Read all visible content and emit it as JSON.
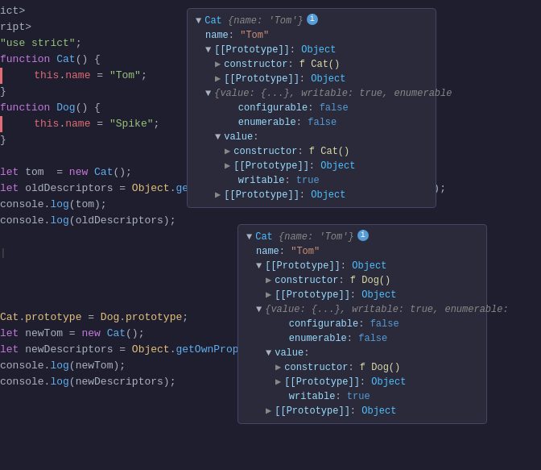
{
  "code": {
    "lines": [
      {
        "num": "",
        "bar": false,
        "content": "ict>"
      },
      {
        "num": "",
        "bar": false,
        "content": "ript>"
      },
      {
        "num": "",
        "bar": false,
        "content": "\"use strict\";"
      },
      {
        "num": "",
        "bar": false,
        "content": "function Cat() {"
      },
      {
        "num": "",
        "bar": true,
        "content": "    this.name = \"Tom\";"
      },
      {
        "num": "",
        "bar": false,
        "content": "}"
      },
      {
        "num": "",
        "bar": false,
        "content": "function Dog() {"
      },
      {
        "num": "",
        "bar": true,
        "content": "    this.name = \"Spike\";"
      },
      {
        "num": "",
        "bar": false,
        "content": "}"
      },
      {
        "num": "",
        "bar": false,
        "content": ""
      },
      {
        "num": "",
        "bar": false,
        "content": "let tom  = new Cat();"
      },
      {
        "num": "",
        "bar": false,
        "content": "let oldDescriptors = Object.getOwnPropertyDescriptor(Cat, 'prototype');"
      },
      {
        "num": "",
        "bar": false,
        "content": "console.log(tom);"
      },
      {
        "num": "",
        "bar": false,
        "content": "console.log(oldDescriptors);"
      },
      {
        "num": "",
        "bar": false,
        "content": ""
      },
      {
        "num": "",
        "bar": false,
        "content": ""
      },
      {
        "num": "",
        "bar": false,
        "content": ""
      },
      {
        "num": "",
        "bar": false,
        "content": ""
      },
      {
        "num": "",
        "bar": false,
        "content": ""
      },
      {
        "num": "",
        "bar": false,
        "content": "Cat.prototype = Dog.prototype;"
      },
      {
        "num": "",
        "bar": false,
        "content": "let newTom = new Cat();"
      },
      {
        "num": "",
        "bar": false,
        "content": "let newDescriptors = Object.getOwnPropertyDescriptor(Cat, 'prototype');"
      },
      {
        "num": "",
        "bar": false,
        "content": "console.log(newTom);"
      },
      {
        "num": "",
        "bar": false,
        "content": "console.log(newDescriptors);"
      }
    ],
    "popup1": {
      "title": "Cat {name: 'Tom'}",
      "info": true,
      "rows": [
        {
          "indent": 1,
          "tri": false,
          "key": "name",
          "sep": ": ",
          "val": "\"Tom\"",
          "valClass": "pop-val-str"
        },
        {
          "indent": 1,
          "tri": true,
          "triDown": true,
          "key": "[[Prototype]]",
          "sep": ": ",
          "val": "Object",
          "valClass": "pop-val-obj"
        },
        {
          "indent": 2,
          "tri": true,
          "triDown": false,
          "key": "constructor",
          "sep": ": ",
          "val": "f Cat()",
          "valClass": "pop-val-fn"
        },
        {
          "indent": 2,
          "tri": true,
          "triDown": false,
          "key": "[[Prototype]]",
          "sep": ": ",
          "val": "Object",
          "valClass": "pop-val-obj"
        },
        {
          "indent": 1,
          "tri": true,
          "triDown": true,
          "key": "{value: {...}, writable: true, enumerable",
          "sep": "",
          "val": "",
          "valClass": ""
        },
        {
          "indent": 2,
          "tri": false,
          "key": "configurable",
          "sep": ": ",
          "val": "false",
          "valClass": "pop-bool"
        },
        {
          "indent": 2,
          "tri": false,
          "key": "enumerable",
          "sep": ": ",
          "val": "false",
          "valClass": "pop-bool"
        },
        {
          "indent": 2,
          "tri": true,
          "triDown": true,
          "key": "value",
          "sep": ":",
          "val": "",
          "valClass": ""
        },
        {
          "indent": 3,
          "tri": true,
          "triDown": false,
          "key": "constructor",
          "sep": ": ",
          "val": "f Cat()",
          "valClass": "pop-val-fn"
        },
        {
          "indent": 3,
          "tri": true,
          "triDown": false,
          "key": "[[Prototype]]",
          "sep": ": ",
          "val": "Object",
          "valClass": "pop-val-obj"
        },
        {
          "indent": 2,
          "tri": false,
          "key": "writable",
          "sep": ": ",
          "val": "true",
          "valClass": "pop-true"
        },
        {
          "indent": 2,
          "tri": true,
          "triDown": false,
          "key": "[[Prototype]]",
          "sep": ": ",
          "val": "Object",
          "valClass": "pop-val-obj"
        }
      ]
    },
    "popup2": {
      "title": "Cat {name: 'Tom'}",
      "info": true,
      "rows": [
        {
          "indent": 1,
          "tri": false,
          "key": "name",
          "sep": ": ",
          "val": "\"Tom\"",
          "valClass": "pop-val-str"
        },
        {
          "indent": 1,
          "tri": true,
          "triDown": true,
          "key": "[[Prototype]]",
          "sep": ": ",
          "val": "Object",
          "valClass": "pop-val-obj"
        },
        {
          "indent": 2,
          "tri": true,
          "triDown": false,
          "key": "constructor",
          "sep": ": ",
          "val": "f Dog()",
          "valClass": "pop-val-fn"
        },
        {
          "indent": 2,
          "tri": true,
          "triDown": false,
          "key": "[[Prototype]]",
          "sep": ": ",
          "val": "Object",
          "valClass": "pop-val-obj"
        },
        {
          "indent": 1,
          "tri": true,
          "triDown": true,
          "key": "{value: {...}, writable: true, enumerable:",
          "sep": "",
          "val": "",
          "valClass": ""
        },
        {
          "indent": 2,
          "tri": false,
          "key": "configurable",
          "sep": ": ",
          "val": "false",
          "valClass": "pop-bool"
        },
        {
          "indent": 2,
          "tri": false,
          "key": "enumerable",
          "sep": ": ",
          "val": "false",
          "valClass": "pop-bool"
        },
        {
          "indent": 2,
          "tri": true,
          "triDown": true,
          "key": "value",
          "sep": ":",
          "val": "",
          "valClass": ""
        },
        {
          "indent": 3,
          "tri": true,
          "triDown": false,
          "key": "constructor",
          "sep": ": ",
          "val": "f Dog()",
          "valClass": "pop-val-fn"
        },
        {
          "indent": 3,
          "tri": true,
          "triDown": false,
          "key": "[[Prototype]]",
          "sep": ": ",
          "val": "Object",
          "valClass": "pop-val-obj"
        },
        {
          "indent": 2,
          "tri": false,
          "key": "writable",
          "sep": ": ",
          "val": "true",
          "valClass": "pop-true"
        },
        {
          "indent": 2,
          "tri": true,
          "triDown": false,
          "key": "[[Prototype]]",
          "sep": ": ",
          "val": "Object",
          "valClass": "pop-val-obj"
        }
      ]
    }
  }
}
